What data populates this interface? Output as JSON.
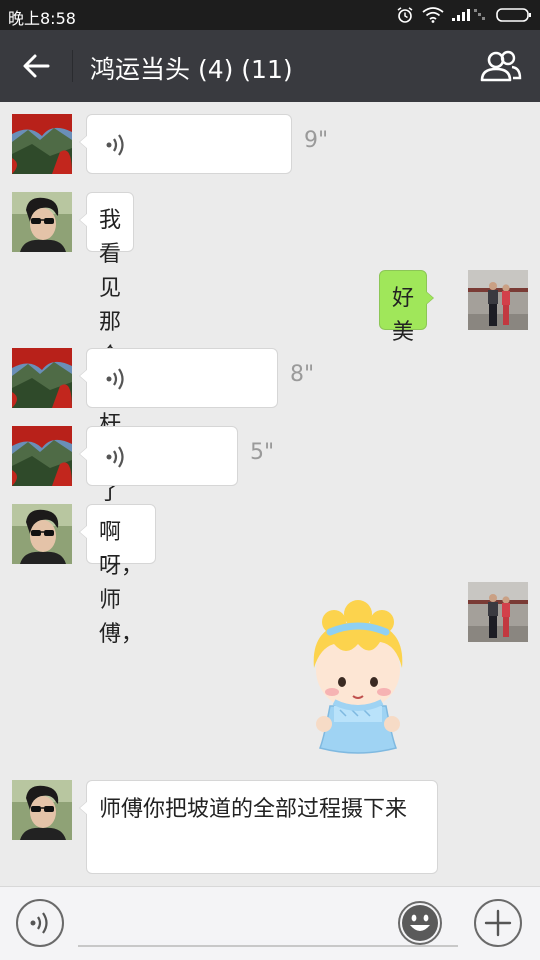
{
  "status_bar": {
    "time": "晚上8:58",
    "icons": [
      "alarm-icon",
      "wifi-icon",
      "signal-icon",
      "battery-icon"
    ]
  },
  "header": {
    "back_icon": "back-arrow-icon",
    "title": "鸿运当头 (4) (11)",
    "members_icon": "group-members-icon",
    "background": "#393a3f"
  },
  "messages": [
    {
      "side": "left",
      "sender_avatar": "landscape",
      "type": "voice",
      "duration": "9\""
    },
    {
      "side": "left",
      "sender_avatar": "man-sunglasses",
      "type": "text",
      "text": "我看见那个铁杆子了"
    },
    {
      "side": "right",
      "sender_avatar": "couple-photo",
      "type": "text",
      "text": "好美"
    },
    {
      "side": "left",
      "sender_avatar": "landscape",
      "type": "voice",
      "duration": "8\""
    },
    {
      "side": "left",
      "sender_avatar": "landscape",
      "type": "voice",
      "duration": "5\""
    },
    {
      "side": "left",
      "sender_avatar": "man-sunglasses",
      "type": "text",
      "text": "啊呀，师傅，"
    },
    {
      "side": "right",
      "sender_avatar": "couple-photo",
      "type": "sticker",
      "sticker": "cartoon-girl-sticker"
    },
    {
      "side": "left",
      "sender_avatar": "man-sunglasses",
      "type": "text",
      "text": "师傅你把坡道的全部过程摄下来"
    }
  ],
  "bottom_bar": {
    "voice_icon": "voice-input-icon",
    "input_value": "",
    "emoji_icon": "emoji-icon",
    "plus_icon": "plus-icon"
  },
  "colors": {
    "chat_background": "#ebebeb",
    "own_bubble": "#a0e75a",
    "other_bubble": "#ffffff"
  }
}
